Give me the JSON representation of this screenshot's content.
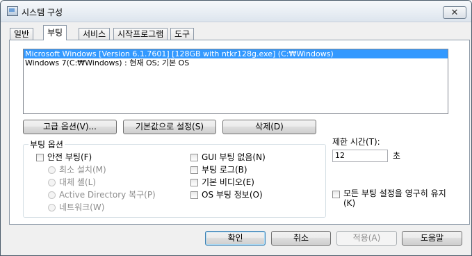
{
  "window": {
    "title": "시스템 구성",
    "close_glyph": "✕"
  },
  "tabs": [
    {
      "label": "일반"
    },
    {
      "label": "부팅"
    },
    {
      "label": "서비스"
    },
    {
      "label": "시작프로그램"
    },
    {
      "label": "도구"
    }
  ],
  "boot_list": [
    "Microsoft Windows [Version 6.1.7601] [128GB with ntkr128g.exe] (C:₩Windows)",
    "Windows 7(C:₩Windows) : 현재 OS; 기본 OS"
  ],
  "buttons": {
    "advanced": "고급 옵션(V)...",
    "set_default": "기본값으로 설정(S)",
    "delete": "삭제(D)",
    "ok": "확인",
    "cancel": "취소",
    "apply": "적용(A)",
    "help": "도움말"
  },
  "boot_options": {
    "title": "부팅 옵션",
    "safe_boot": "안전 부팅(F)",
    "minimal": "최소 설치(M)",
    "alternate_shell": "대체 셸(L)",
    "ad_repair": "Active Directory 복구(P)",
    "network": "네트워크(W)",
    "no_gui_boot": "GUI 부팅 없음(N)",
    "boot_log": "부팅 로그(B)",
    "base_video": "기본 비디오(E)",
    "os_boot_info": "OS 부팅 정보(O)"
  },
  "timeout": {
    "label": "제한 시간(T):",
    "value": "12",
    "unit": "초"
  },
  "permanent": {
    "label_line1": "모든 부팅 설정을 영구히 유지",
    "label_line2": "(K)"
  }
}
